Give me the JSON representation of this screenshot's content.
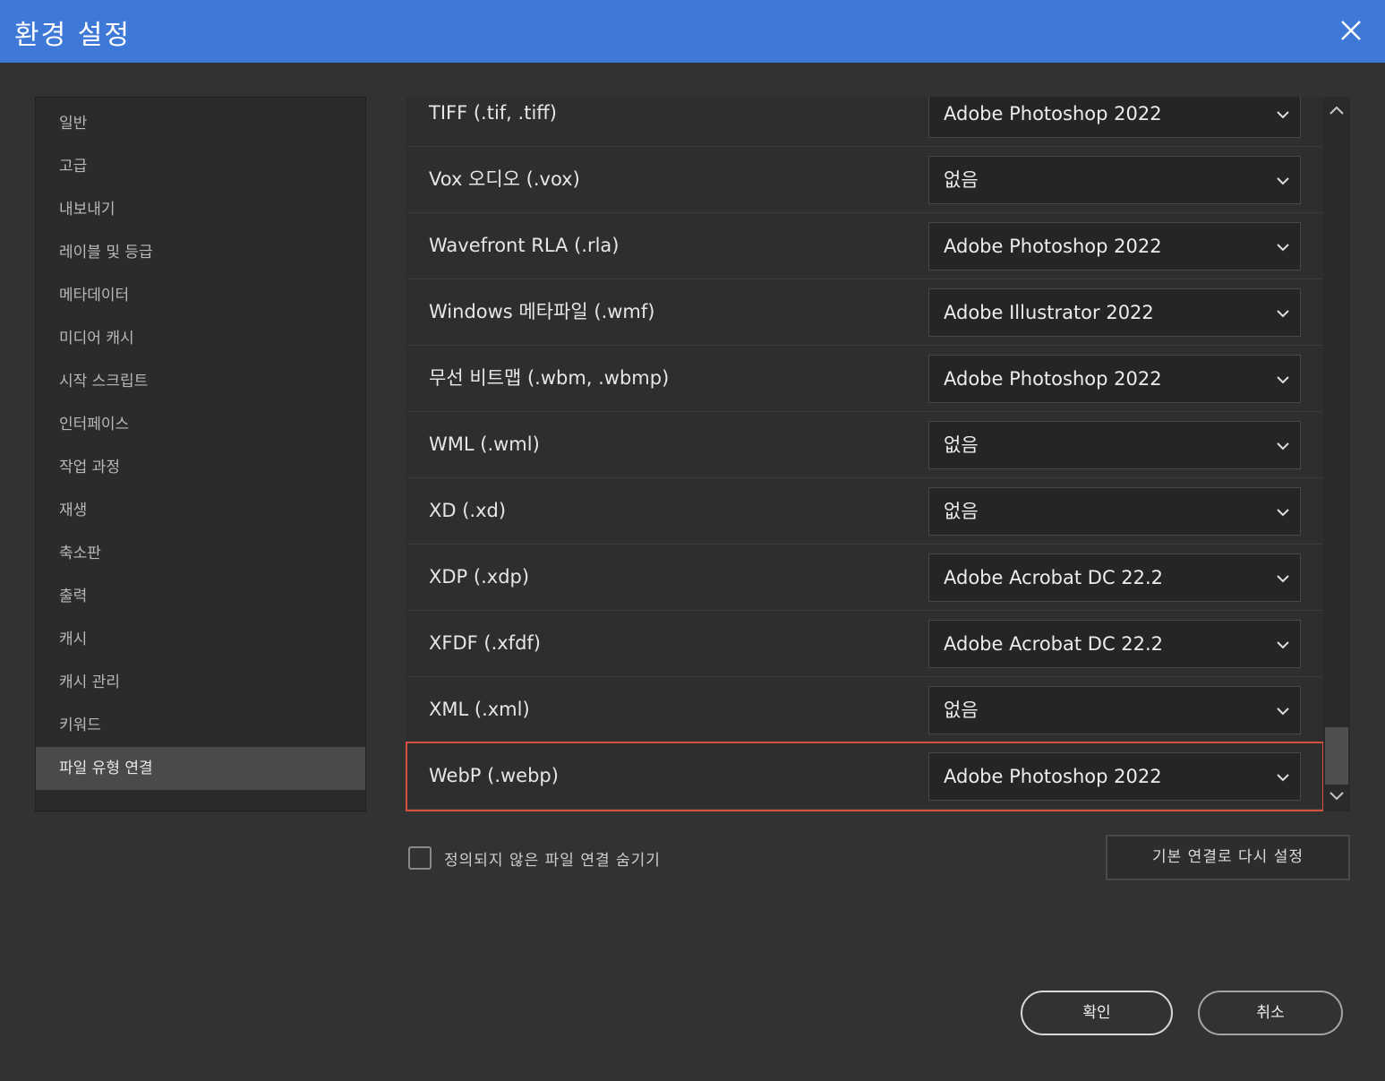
{
  "dialog": {
    "title": "환경 설정"
  },
  "sidebar": {
    "items": [
      {
        "label": "일반",
        "active": false
      },
      {
        "label": "고급",
        "active": false
      },
      {
        "label": "내보내기",
        "active": false
      },
      {
        "label": "레이블 및 등급",
        "active": false
      },
      {
        "label": "메타데이터",
        "active": false
      },
      {
        "label": "미디어 캐시",
        "active": false
      },
      {
        "label": "시작 스크립트",
        "active": false
      },
      {
        "label": "인터페이스",
        "active": false
      },
      {
        "label": "작업 과정",
        "active": false
      },
      {
        "label": "재생",
        "active": false
      },
      {
        "label": "축소판",
        "active": false
      },
      {
        "label": "출력",
        "active": false
      },
      {
        "label": "캐시",
        "active": false
      },
      {
        "label": "캐시 관리",
        "active": false
      },
      {
        "label": "키워드",
        "active": false
      },
      {
        "label": "파일 유형 연결",
        "active": true
      }
    ]
  },
  "associations": {
    "rows": [
      {
        "file_type": "TIFF (.tif, .tiff)",
        "app": "Adobe Photoshop 2022",
        "highlighted": false
      },
      {
        "file_type": "Vox 오디오 (.vox)",
        "app": "없음",
        "highlighted": false
      },
      {
        "file_type": "Wavefront RLA (.rla)",
        "app": "Adobe Photoshop 2022",
        "highlighted": false
      },
      {
        "file_type": "Windows 메타파일 (.wmf)",
        "app": "Adobe Illustrator 2022",
        "highlighted": false
      },
      {
        "file_type": "무선 비트맵 (.wbm, .wbmp)",
        "app": "Adobe Photoshop 2022",
        "highlighted": false
      },
      {
        "file_type": "WML (.wml)",
        "app": "없음",
        "highlighted": false
      },
      {
        "file_type": "XD (.xd)",
        "app": "없음",
        "highlighted": false
      },
      {
        "file_type": "XDP (.xdp)",
        "app": "Adobe Acrobat DC 22.2",
        "highlighted": false
      },
      {
        "file_type": "XFDF (.xfdf)",
        "app": "Adobe Acrobat DC 22.2",
        "highlighted": false
      },
      {
        "file_type": "XML (.xml)",
        "app": "없음",
        "highlighted": false
      },
      {
        "file_type": "WebP (.webp)",
        "app": "Adobe Photoshop 2022",
        "highlighted": true
      }
    ],
    "highlight_color": "#d9503f"
  },
  "options": {
    "hide_undefined_label": "정의되지 않은 파일 연결 숨기기",
    "hide_undefined_checked": false,
    "reset_label": "기본 연결로 다시 설정"
  },
  "footer": {
    "ok_label": "확인",
    "cancel_label": "취소"
  },
  "colors": {
    "titlebar": "#3f79d8",
    "background": "#323232",
    "active_item": "#4a4a4a"
  }
}
